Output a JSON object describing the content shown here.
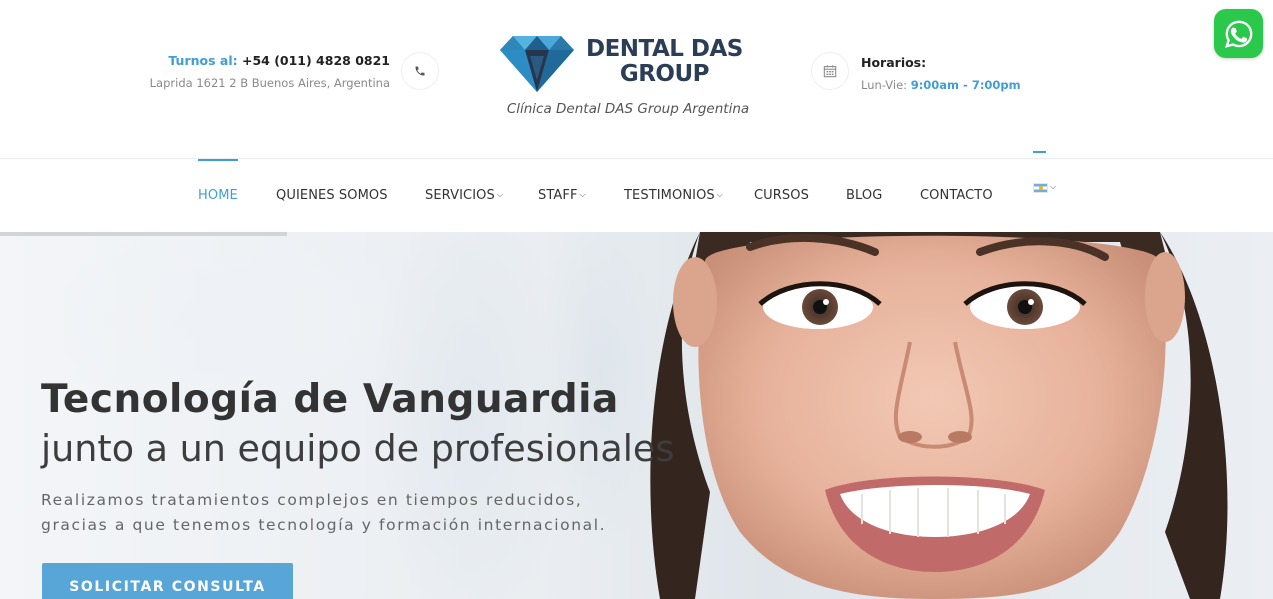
{
  "header": {
    "turnos_label": "Turnos al:",
    "phone": "+54 (011) 4828 0821",
    "address": "Laprida 1621 2 B Buenos Aires, Argentina",
    "logo_line1": "DENTAL DAS",
    "logo_line2": "GROUP",
    "tagline": "Clínica Dental DAS Group Argentina",
    "hours_title": "Horarios:",
    "hours_days": "Lun-Vie: ",
    "hours_time": "9:00am - 7:00pm"
  },
  "nav": {
    "items": [
      {
        "label": "HOME"
      },
      {
        "label": "QUIENES SOMOS"
      },
      {
        "label": "SERVICIOS"
      },
      {
        "label": "STAFF"
      },
      {
        "label": "TESTIMONIOS"
      },
      {
        "label": "CURSOS"
      },
      {
        "label": "BLOG"
      },
      {
        "label": "CONTACTO"
      }
    ]
  },
  "hero": {
    "title": "Tecnología de Vanguardia",
    "subtitle": "junto a un equipo de profesionales",
    "desc_line1": "Realizamos tratamientos complejos en tiempos reducidos,",
    "desc_line2": "gracias a que tenemos tecnología y formación internacional.",
    "cta": "SOLICITAR CONSULTA"
  },
  "colors": {
    "accent": "#3f9ed6",
    "button": "#58a6d8",
    "logo_text": "#2c3e55",
    "whatsapp": "#2ac94b"
  },
  "icons": [
    "phone-icon",
    "calendar-icon",
    "whatsapp-icon",
    "argentina-flag-icon",
    "chevron-down-icon"
  ]
}
